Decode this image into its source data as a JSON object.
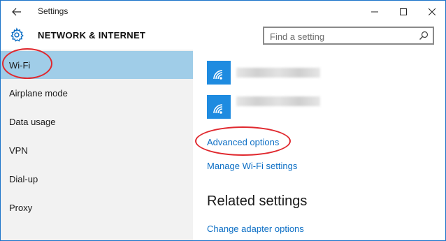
{
  "window": {
    "title": "Settings",
    "controls": {
      "minimize_icon": "minimize-icon",
      "maximize_icon": "maximize-icon",
      "close_icon": "close-icon"
    }
  },
  "header": {
    "section_title": "NETWORK & INTERNET",
    "section_icon": "gear-icon",
    "search": {
      "placeholder": "Find a setting",
      "icon": "search-icon"
    }
  },
  "sidebar": {
    "items": [
      {
        "label": "Wi-Fi",
        "selected": true
      },
      {
        "label": "Airplane mode",
        "selected": false
      },
      {
        "label": "Data usage",
        "selected": false
      },
      {
        "label": "VPN",
        "selected": false
      },
      {
        "label": "Dial-up",
        "selected": false
      },
      {
        "label": "Proxy",
        "selected": false
      }
    ]
  },
  "content": {
    "networks": [
      {
        "icon": "wifi-icon"
      },
      {
        "icon": "wifi-icon"
      }
    ],
    "advanced_options": "Advanced options",
    "manage_wifi": "Manage Wi-Fi settings",
    "related_heading": "Related settings",
    "change_adapter": "Change adapter options"
  },
  "colors": {
    "accent": "#0d6fc5",
    "selected_bg": "#a0cde8",
    "sidebar_bg": "#f2f2f2",
    "wifi_tile": "#1e8be0",
    "annotation": "#e0282e"
  }
}
